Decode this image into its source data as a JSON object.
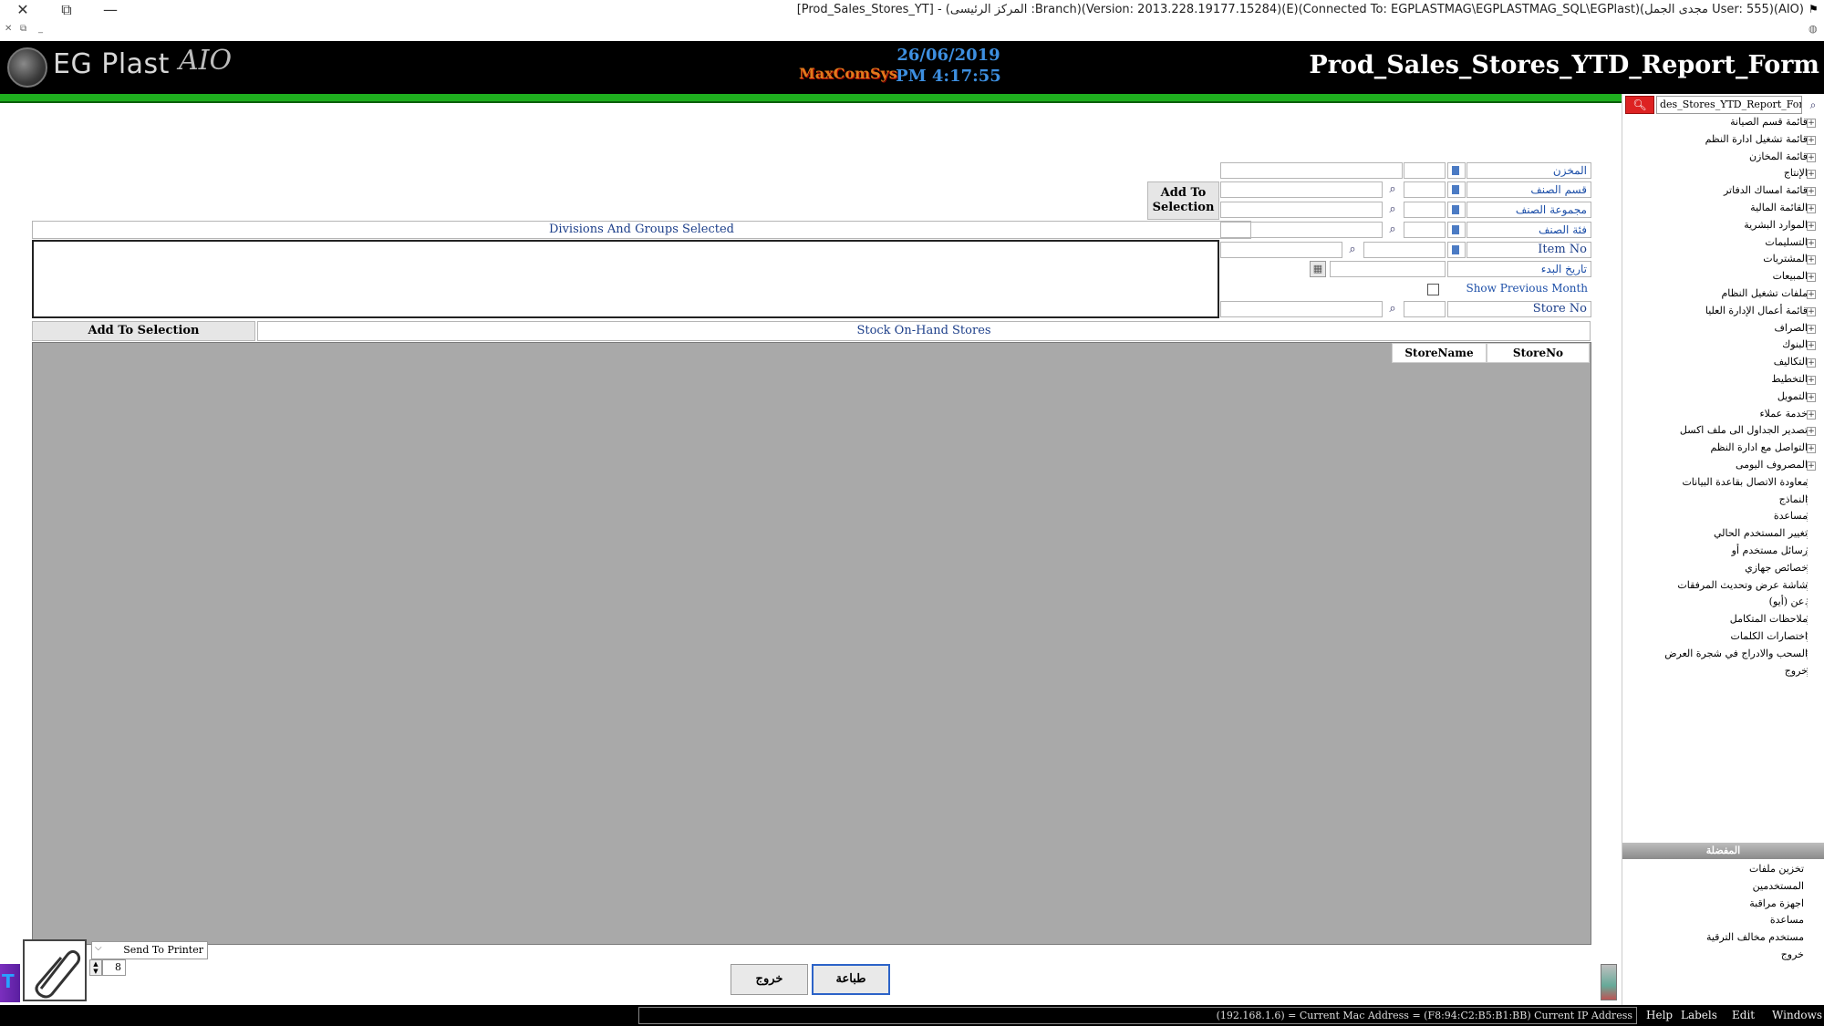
{
  "window": {
    "title": "[Prod_Sales_Stores_YT] - (المركز الرئيسى :Branch)(Version: 2013.228.19177.15284)(E)(Connected To: EGPLASTMAG\\EGPLASTMAG_SQL\\EGPlast)(مجدى الجمل User: 555)(AIO)",
    "close": "✕",
    "restore": "⧉",
    "minimize": "—"
  },
  "header": {
    "logo_text": "EG Plast",
    "logo_suffix": "AIO",
    "brand": "MaxComSys",
    "date": "26/06/2019",
    "time": "PM 4:17:55",
    "form_title": "Prod_Sales_Stores_YTD_Report_Form"
  },
  "filters": {
    "store_label": "المخزن",
    "division_label": "قسم الصنف",
    "group_label": "مجموعة الصنف",
    "category_label": "فئة الصنف",
    "item_no_label": "Item No",
    "start_date_label": "تاريخ البدء",
    "show_prev_month": "Show Previous Month",
    "store_no_label": "Store No",
    "add_to_selection": "Add To Selection"
  },
  "divisions": {
    "header": "Divisions And Groups Selected"
  },
  "stores": {
    "add_to_selection": "Add To Selection",
    "header": "Stock On-Hand Stores",
    "columns": [
      "StoreName",
      "StoreNo"
    ]
  },
  "bottom": {
    "send_to_printer": "Send To Printer",
    "copies": "8",
    "exit": "خروج",
    "print": "طباعة"
  },
  "status": {
    "info": "(192.168.1.6) = Current Mac Address = (F8:94:C2:B5:B1:BB) Current IP Address",
    "menu": [
      "Help",
      "Labels",
      "Edit",
      "Windows"
    ]
  },
  "sidebar": {
    "search_value": "des_Stores_YTD_Report_Form",
    "tree": [
      {
        "label": "قائمة قسم الصيانة",
        "exp": true
      },
      {
        "label": "قائمة تشغيل ادارة النظم",
        "exp": true
      },
      {
        "label": "قائمة المخازن",
        "exp": true
      },
      {
        "label": "الإنتاج",
        "exp": true
      },
      {
        "label": "قائمة امساك الدفاتر",
        "exp": true
      },
      {
        "label": "القائمة المالية",
        "exp": true
      },
      {
        "label": "الموارد البشرية",
        "exp": true
      },
      {
        "label": "التسليمات",
        "exp": true
      },
      {
        "label": "المشتريات",
        "exp": true
      },
      {
        "label": "المبيعات",
        "exp": true
      },
      {
        "label": "ملفات تشغيل النظام",
        "exp": true
      },
      {
        "label": "قائمة أعمال الإدارة العليا",
        "exp": true
      },
      {
        "label": "الصراف",
        "exp": true
      },
      {
        "label": "البنوك",
        "exp": true
      },
      {
        "label": "التكاليف",
        "exp": true
      },
      {
        "label": "التخطيط",
        "exp": true
      },
      {
        "label": "التمويل",
        "exp": true
      },
      {
        "label": "خدمة عملاء",
        "exp": true
      },
      {
        "label": "تصدير الجداول الى ملف اكسل",
        "exp": true
      },
      {
        "label": "التواصل مع ادارة النظم",
        "exp": true
      },
      {
        "label": "المصروف اليومى",
        "exp": true
      },
      {
        "label": "معاودة الاتصال بقاعدة البيانات",
        "exp": false
      },
      {
        "label": "النماذج",
        "exp": false
      },
      {
        "label": "مساعدة",
        "exp": false
      },
      {
        "label": "تغيير المستخدم الحالي",
        "exp": false
      },
      {
        "label": "رسائل مستخدم أو",
        "exp": false
      },
      {
        "label": "خصائص جهازي",
        "exp": false
      },
      {
        "label": "شاشة عرض وتحديث المرفقات",
        "exp": false
      },
      {
        "label": "عن (أيو).",
        "exp": false
      },
      {
        "label": "ملاحظات المتكامل",
        "exp": false
      },
      {
        "label": "اختصارات الكلمات",
        "exp": false
      },
      {
        "label": "السحب والادراج في شجرة العرض",
        "exp": false
      },
      {
        "label": "خروج",
        "exp": false
      }
    ],
    "favorites_header": "المفضلة",
    "favorites": [
      "تخزين ملفات",
      "المستخدمين",
      "اجهزة مراقبة",
      "مساعدة",
      "مستخدم مخالف الترقية",
      "خروج"
    ]
  }
}
